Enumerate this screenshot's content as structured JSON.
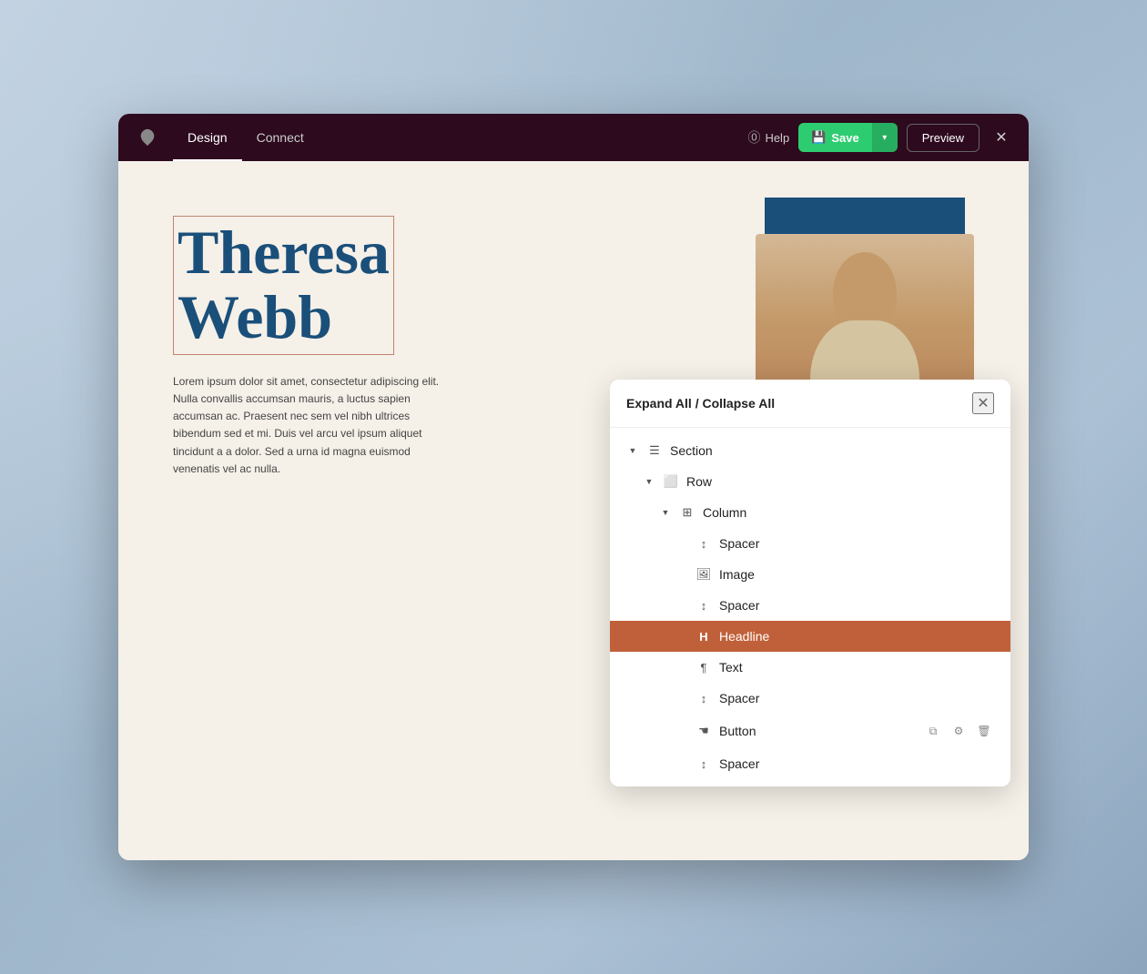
{
  "nav": {
    "tabs": [
      {
        "id": "design",
        "label": "Design",
        "active": true
      },
      {
        "id": "connect",
        "label": "Connect",
        "active": false
      }
    ],
    "help_label": "Help",
    "save_label": "Save",
    "preview_label": "Preview"
  },
  "canvas": {
    "headline": "Theresa\nWebb",
    "body_text": "Lorem ipsum dolor sit amet, consectetur adipiscing elit. Nulla convallis accumsan mauris, a luctus sapien accumsan ac. Praesent nec sem vel nibh ultrices bibendum sed et mi. Duis vel arcu vel ipsum aliquet tincidunt a a dolor. Sed a urna id magna euismod venenatis vel ac nulla."
  },
  "panel": {
    "header_title": "Expand All / Collapse All",
    "expand_label": "Expand All",
    "collapse_label": "Collapse All",
    "tree": [
      {
        "id": "section",
        "label": "Section",
        "indent": 0,
        "icon": "section-icon",
        "arrow": "down",
        "active": false
      },
      {
        "id": "row",
        "label": "Row",
        "indent": 1,
        "icon": "row-icon",
        "arrow": "down",
        "active": false
      },
      {
        "id": "column",
        "label": "Column",
        "indent": 2,
        "icon": "column-icon",
        "arrow": "down",
        "active": false
      },
      {
        "id": "spacer-1",
        "label": "Spacer",
        "indent": 3,
        "icon": "spacer-icon",
        "arrow": null,
        "active": false
      },
      {
        "id": "image",
        "label": "Image",
        "indent": 3,
        "icon": "image-icon",
        "arrow": null,
        "active": false
      },
      {
        "id": "spacer-2",
        "label": "Spacer",
        "indent": 3,
        "icon": "spacer-icon",
        "arrow": null,
        "active": false
      },
      {
        "id": "headline",
        "label": "Headline",
        "indent": 3,
        "icon": "headline-icon",
        "arrow": null,
        "active": true
      },
      {
        "id": "text",
        "label": "Text",
        "indent": 3,
        "icon": "text-icon",
        "arrow": null,
        "active": false
      },
      {
        "id": "spacer-3",
        "label": "Spacer",
        "indent": 3,
        "icon": "spacer-icon",
        "arrow": null,
        "active": false
      },
      {
        "id": "button",
        "label": "Button",
        "indent": 3,
        "icon": "button-icon",
        "arrow": null,
        "active": false,
        "has_actions": true
      },
      {
        "id": "spacer-4",
        "label": "Spacer",
        "indent": 3,
        "icon": "spacer-icon",
        "arrow": null,
        "active": false
      }
    ],
    "actions": {
      "copy": "⧉",
      "settings": "⚙",
      "delete": "🗑"
    }
  }
}
